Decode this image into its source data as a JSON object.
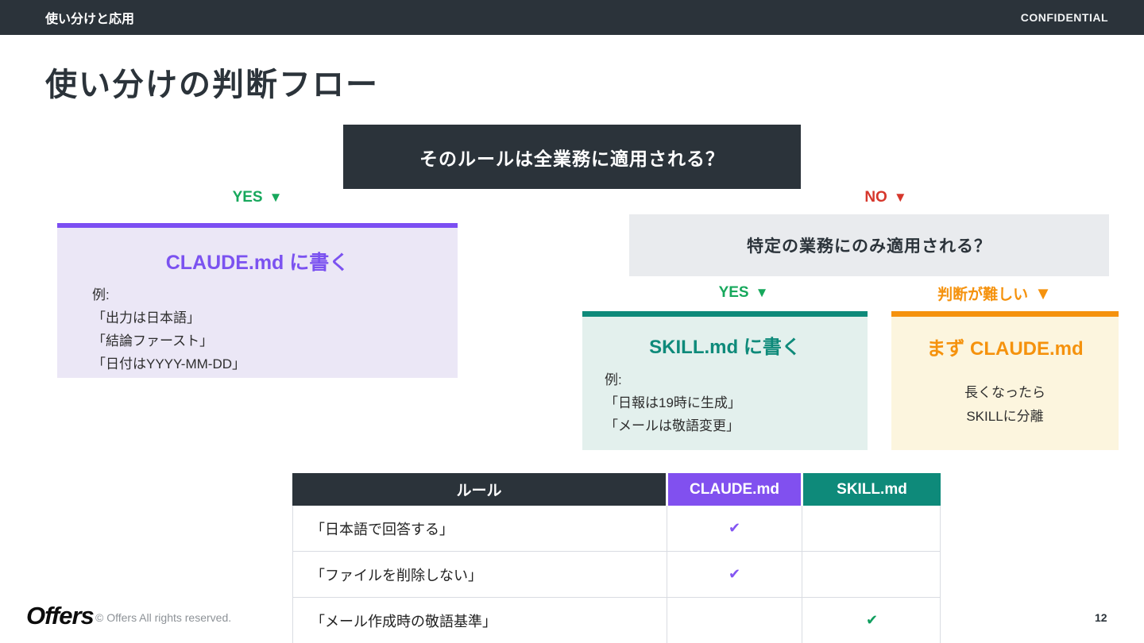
{
  "header": {
    "section_label": "使い分けと応用",
    "confidential": "CONFIDENTIAL"
  },
  "title": "使い分けの判断フロー",
  "flow": {
    "root_question": "そのルールは全業務に適用される？",
    "arrow": "▼",
    "yes_label": "YES",
    "no_label": "NO",
    "claude_box": {
      "title": "CLAUDE.md に書く",
      "example_label": "例:",
      "examples": [
        "「出力は日本語」",
        "「結論ファースト」",
        "「日付はYYYY-MM-DD」"
      ]
    },
    "sub_question": "特定の業務にのみ適用される？",
    "sub_yes_label": "YES",
    "hard_label": "判断が難しい",
    "skill_box": {
      "title": "SKILL.md に書く",
      "example_label": "例:",
      "examples": [
        "「日報は19時に生成」",
        "「メールは敬語変更」"
      ]
    },
    "fallback_box": {
      "title": "まず CLAUDE.md",
      "lines": [
        "長くなったら",
        "SKILLに分離"
      ]
    }
  },
  "table": {
    "headers": [
      "ルール",
      "CLAUDE.md",
      "SKILL.md"
    ],
    "rows": [
      {
        "rule": "「日本語で回答する」",
        "claude": "✔",
        "skill": ""
      },
      {
        "rule": "「ファイルを削除しない」",
        "claude": "✔",
        "skill": ""
      },
      {
        "rule": "「メール作成時の敬語基準」",
        "claude": "",
        "skill": "✔"
      }
    ]
  },
  "footer": {
    "logo": "Offers",
    "copyright": "© Offers All rights reserved.",
    "page_number": "12"
  },
  "colors": {
    "dark": "#2b333a",
    "purple": "#7b4ef2",
    "teal": "#0e8a7a",
    "orange": "#f5920d",
    "green": "#17a85c",
    "red": "#d6372c"
  }
}
